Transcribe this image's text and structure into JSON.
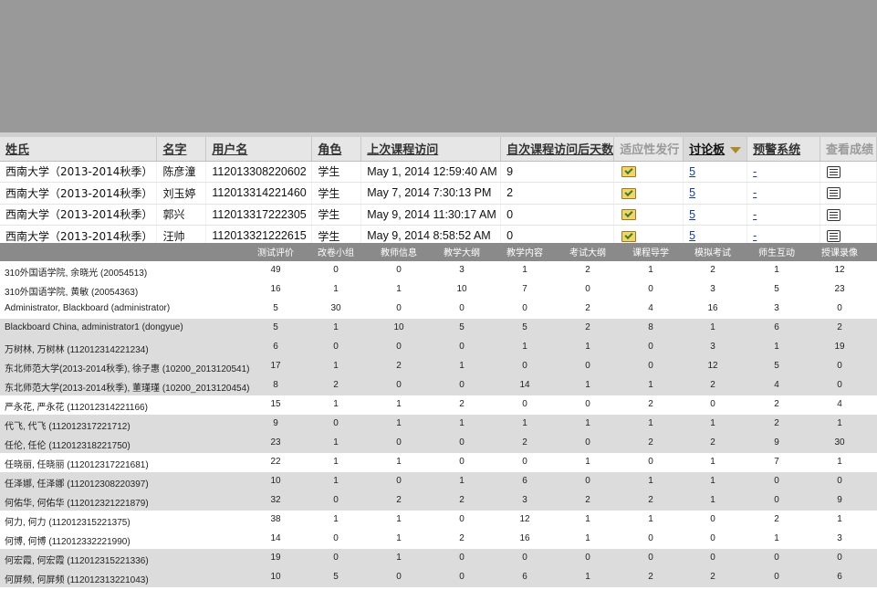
{
  "grade_center": {
    "columns": [
      {
        "label": "姓氏",
        "dim": false
      },
      {
        "label": "名字",
        "dim": false
      },
      {
        "label": "用户名",
        "dim": false
      },
      {
        "label": "角色",
        "dim": false
      },
      {
        "label": "上次课程访问",
        "dim": false
      },
      {
        "label": "自次课程访问后天数",
        "dim": false
      },
      {
        "label": "适应性发行",
        "dim": true
      },
      {
        "label": "讨论板",
        "dim": false,
        "sorted": true
      },
      {
        "label": "预警系统",
        "dim": false
      },
      {
        "label": "查看成绩",
        "dim": true
      }
    ],
    "rows": [
      {
        "last": "西南大学（2013-2014秋季）",
        "first": "陈彦潼",
        "username": "112013308220602",
        "role": "学生",
        "last_access": "May 1, 2014 12:59:40 AM",
        "days": "9",
        "discussion": "5",
        "alert": "-"
      },
      {
        "last": "西南大学（2013-2014秋季）",
        "first": "刘玉婷",
        "username": "112013314221460",
        "role": "学生",
        "last_access": "May 7, 2014 7:30:13 PM",
        "days": "2",
        "discussion": "5",
        "alert": "-"
      },
      {
        "last": "西南大学（2013-2014秋季）",
        "first": "郭兴",
        "username": "112013317222305",
        "role": "学生",
        "last_access": "May 9, 2014 11:30:17 AM",
        "days": "0",
        "discussion": "5",
        "alert": "-"
      },
      {
        "last": "西南大学（2013-2014秋季）",
        "first": "汪帅",
        "username": "112013321222615",
        "role": "学生",
        "last_access": "May 9, 2014 8:58:52 AM",
        "days": "0",
        "discussion": "5",
        "alert": "-"
      }
    ]
  },
  "stats": {
    "headers": [
      "测试评价",
      "改卷小组",
      "教师信息",
      "教学大纲",
      "教学内容",
      "考试大纲",
      "课程导学",
      "模拟考试",
      "师生互动",
      "授课录像"
    ],
    "rows": [
      {
        "name": "310外国语学院, 余晓光 (20054513)",
        "values": [
          "49",
          "0",
          "0",
          "3",
          "1",
          "2",
          "1",
          "2",
          "1",
          "12"
        ]
      },
      {
        "name": "310外国语学院, 黄敏 (20054363)",
        "values": [
          "16",
          "1",
          "1",
          "10",
          "7",
          "0",
          "0",
          "3",
          "5",
          "23"
        ]
      },
      {
        "name": "Administrator, Blackboard (administrator)",
        "values": [
          "5",
          "30",
          "0",
          "0",
          "0",
          "2",
          "4",
          "16",
          "3",
          "0"
        ]
      },
      {
        "name": "Blackboard China, administrator1 (dongyue)",
        "values": [
          "5",
          "1",
          "10",
          "5",
          "5",
          "2",
          "8",
          "1",
          "6",
          "2"
        ]
      },
      {
        "name": "万树林, 万树林 (112012314221234)",
        "values": [
          "6",
          "0",
          "0",
          "0",
          "1",
          "1",
          "0",
          "3",
          "1",
          "19"
        ]
      },
      {
        "name": "东北师范大学(2013-2014秋季), 徐子惠 (10200_2013120541)",
        "values": [
          "17",
          "1",
          "2",
          "1",
          "0",
          "0",
          "0",
          "12",
          "5",
          "0"
        ]
      },
      {
        "name": "东北师范大学(2013-2014秋季), 董瑾瑾 (10200_2013120454)",
        "values": [
          "8",
          "2",
          "0",
          "0",
          "14",
          "1",
          "1",
          "2",
          "4",
          "0"
        ]
      },
      {
        "name": "严永花, 严永花 (112012314221166)",
        "values": [
          "15",
          "1",
          "1",
          "2",
          "0",
          "0",
          "2",
          "0",
          "2",
          "4"
        ]
      },
      {
        "name": "代飞, 代飞 (112012317221712)",
        "values": [
          "9",
          "0",
          "1",
          "1",
          "1",
          "1",
          "1",
          "1",
          "2",
          "1"
        ]
      },
      {
        "name": "任伦, 任伦 (112012318221750)",
        "values": [
          "23",
          "1",
          "0",
          "0",
          "2",
          "0",
          "2",
          "2",
          "9",
          "30"
        ]
      },
      {
        "name": "任晓丽, 任晓丽 (112012317221681)",
        "values": [
          "22",
          "1",
          "1",
          "0",
          "0",
          "1",
          "0",
          "1",
          "7",
          "1"
        ]
      },
      {
        "name": "任泽娜, 任泽娜 (112012308220397)",
        "values": [
          "10",
          "1",
          "0",
          "1",
          "6",
          "0",
          "1",
          "1",
          "0",
          "0"
        ]
      },
      {
        "name": "何佑华, 何佑华 (112012321221879)",
        "values": [
          "32",
          "0",
          "2",
          "2",
          "3",
          "2",
          "2",
          "1",
          "0",
          "9"
        ]
      },
      {
        "name": "何力, 何力 (112012315221375)",
        "values": [
          "38",
          "1",
          "1",
          "0",
          "12",
          "1",
          "1",
          "0",
          "2",
          "1"
        ]
      },
      {
        "name": "何博, 何博 (112012332221990)",
        "values": [
          "14",
          "0",
          "1",
          "2",
          "16",
          "1",
          "0",
          "0",
          "1",
          "3"
        ]
      },
      {
        "name": "何宏霞, 何宏霞 (112012315221336)",
        "values": [
          "19",
          "0",
          "1",
          "0",
          "0",
          "0",
          "0",
          "0",
          "0",
          "0"
        ]
      },
      {
        "name": "何屏频, 何屏频 (112012313221043)",
        "values": [
          "10",
          "5",
          "0",
          "0",
          "6",
          "1",
          "2",
          "2",
          "0",
          "6"
        ]
      }
    ]
  }
}
